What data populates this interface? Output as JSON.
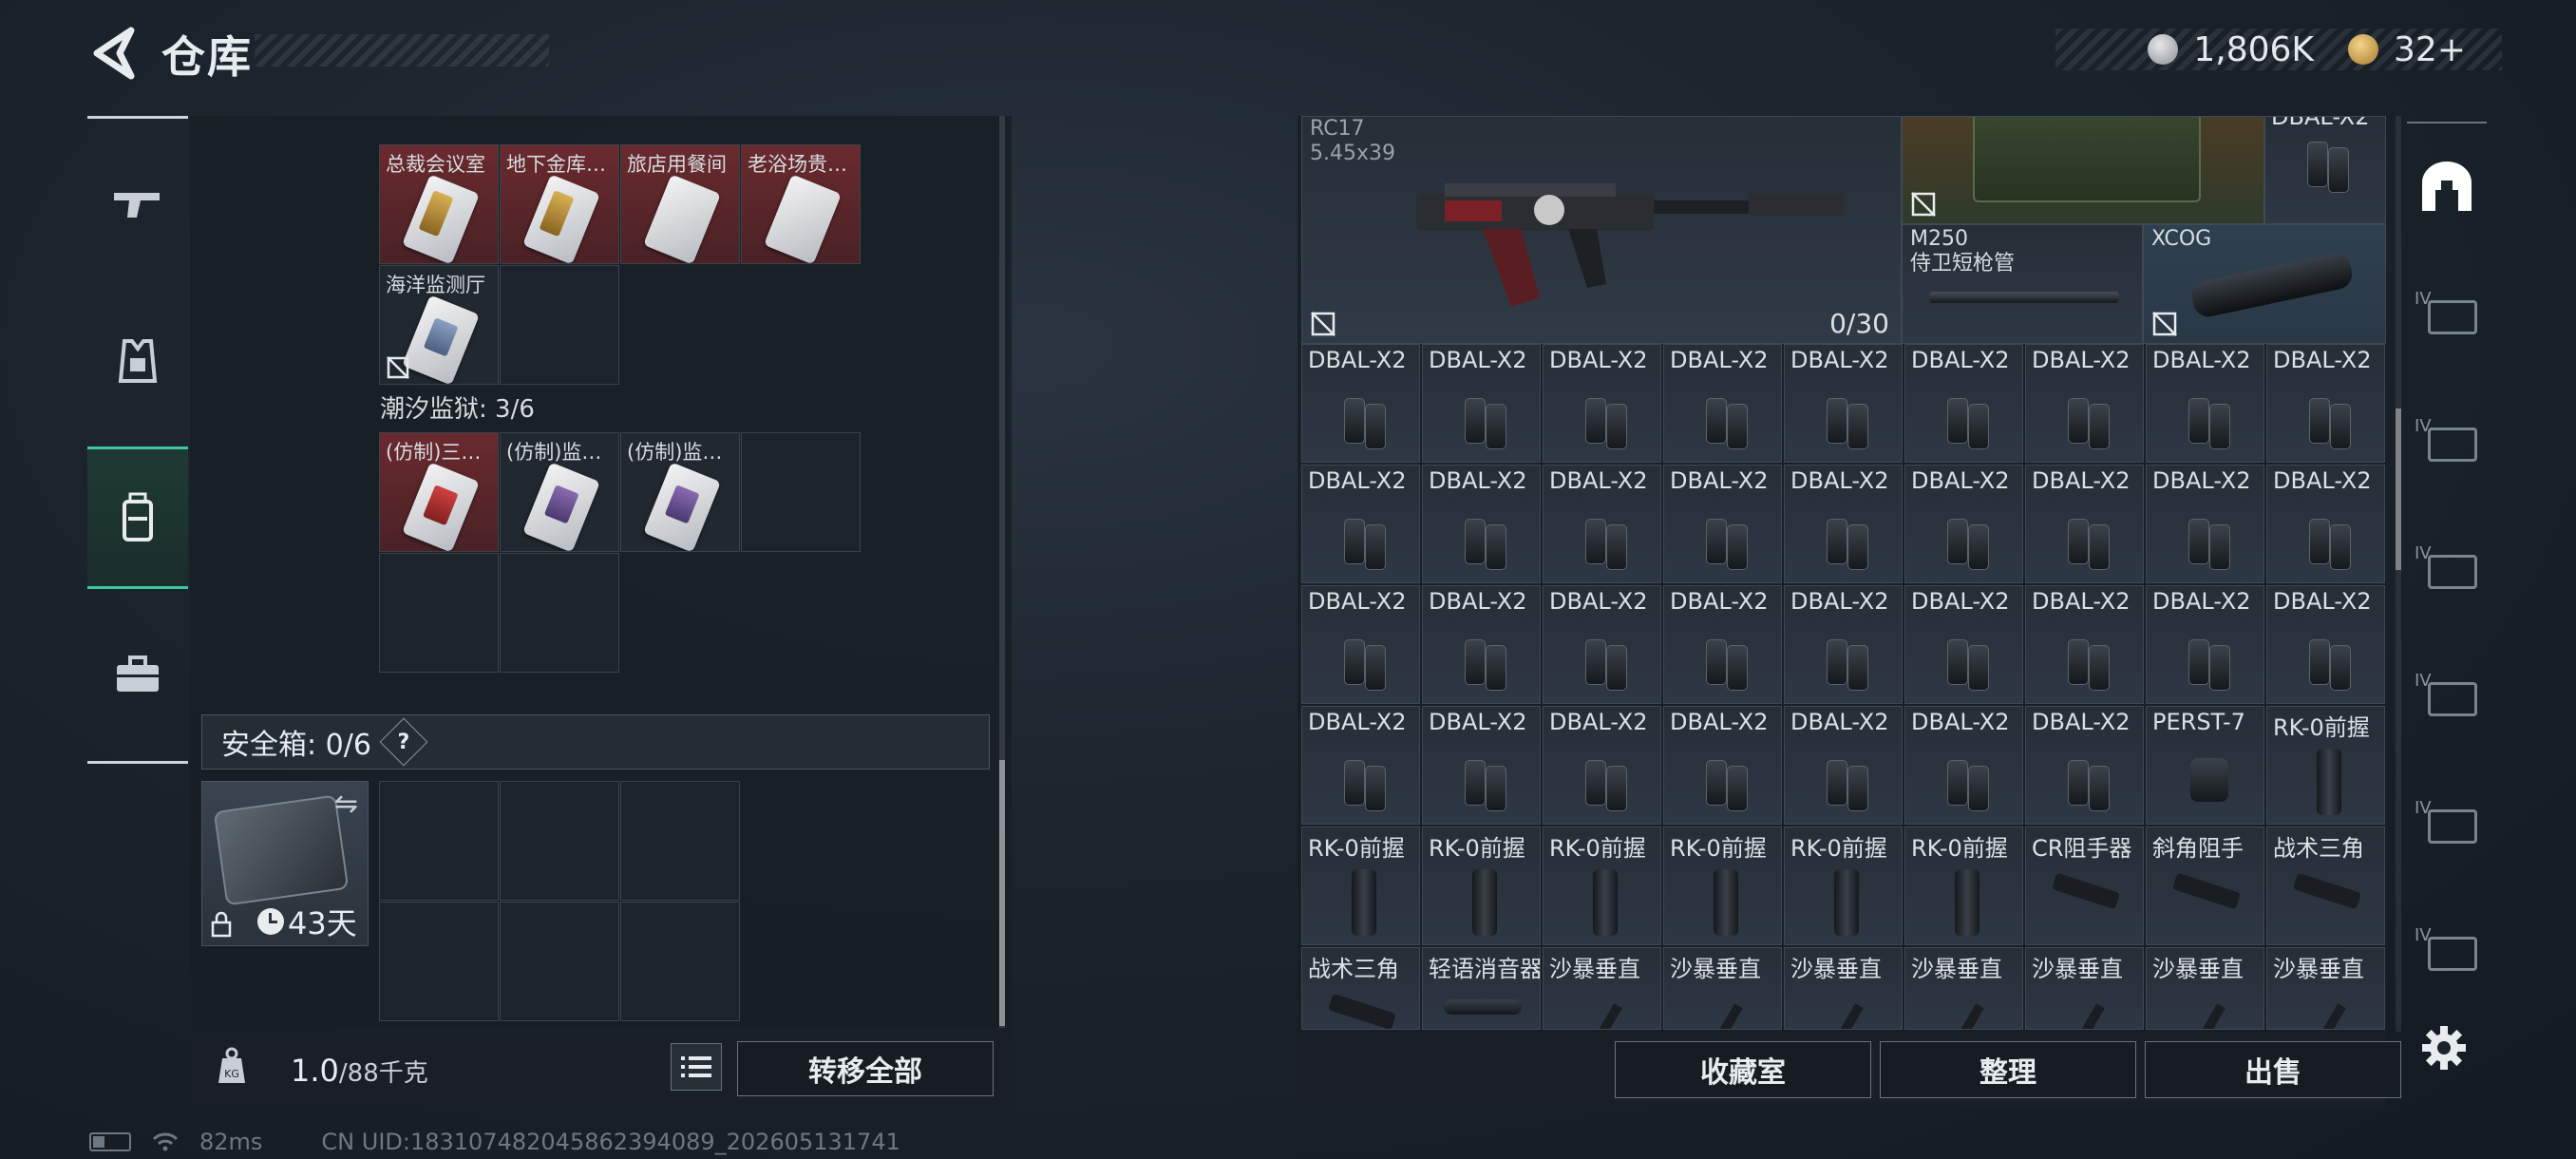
{
  "header": {
    "title": "仓库",
    "silver": "1,806K",
    "gold": "32+"
  },
  "left_nav": [
    {
      "name": "weapon",
      "icon": "rifle-icon"
    },
    {
      "name": "armor",
      "icon": "vest-icon"
    },
    {
      "name": "backpack",
      "icon": "backpack-icon"
    },
    {
      "name": "case",
      "icon": "briefcase-icon"
    }
  ],
  "left": {
    "row1": [
      "总裁会议室",
      "地下金库…",
      "旅店用餐间",
      "老浴场贵…"
    ],
    "row2": [
      "海洋监测厅"
    ],
    "section2_title": "潮汐监狱: 3/6",
    "row3": [
      "(仿制)三…",
      "(仿制)监…",
      "(仿制)监…"
    ],
    "safe_label": "安全箱: 0/6",
    "safe_help": "?",
    "case_time": "43天",
    "weight_value": "1.0",
    "weight_max": "/88千克",
    "transfer_all": "转移全部"
  },
  "right": {
    "gun_name": "RC17",
    "gun_caliber": "5.45x39",
    "gun_ammo": "0/30",
    "top_dbal": "DBAL-X2",
    "m250_line1": "M250",
    "m250_line2": "侍卫短枪管",
    "xcog": "XCOG",
    "rows": [
      [
        "DBAL-X2",
        "DBAL-X2",
        "DBAL-X2",
        "DBAL-X2",
        "DBAL-X2",
        "DBAL-X2",
        "DBAL-X2",
        "DBAL-X2",
        "DBAL-X2"
      ],
      [
        "DBAL-X2",
        "DBAL-X2",
        "DBAL-X2",
        "DBAL-X2",
        "DBAL-X2",
        "DBAL-X2",
        "DBAL-X2",
        "DBAL-X2",
        "DBAL-X2"
      ],
      [
        "DBAL-X2",
        "DBAL-X2",
        "DBAL-X2",
        "DBAL-X2",
        "DBAL-X2",
        "DBAL-X2",
        "DBAL-X2",
        "DBAL-X2",
        "DBAL-X2"
      ],
      [
        "DBAL-X2",
        "DBAL-X2",
        "DBAL-X2",
        "DBAL-X2",
        "DBAL-X2",
        "DBAL-X2",
        "DBAL-X2",
        "PERST-7",
        "RK-0前握"
      ],
      [
        "RK-0前握",
        "RK-0前握",
        "RK-0前握",
        "RK-0前握",
        "RK-0前握",
        "RK-0前握",
        "CR阻手器",
        "斜角阻手",
        "战术三角"
      ],
      [
        "战术三角",
        "轻语消音器",
        "沙暴垂直",
        "沙暴垂直",
        "沙暴垂直",
        "沙暴垂直",
        "沙暴垂直",
        "沙暴垂直",
        "沙暴垂直"
      ]
    ],
    "btn_collection": "收藏室",
    "btn_sort": "整理",
    "btn_sell": "出售"
  },
  "right_nav": [
    {
      "icon": "home-icon"
    },
    {
      "tier": "IV",
      "icon": "weapon-slot-icon"
    },
    {
      "tier": "IV",
      "icon": "weapon-slot-icon"
    },
    {
      "tier": "IV",
      "icon": "medical-icon"
    },
    {
      "tier": "IV",
      "icon": "gear-box-icon"
    },
    {
      "tier": "IV",
      "icon": "folder-icon"
    },
    {
      "tier": "IV",
      "icon": "key-icon"
    }
  ],
  "status": {
    "ping": "82ms",
    "uid": "CN UID:18310748204586239408​9_202605131741"
  }
}
